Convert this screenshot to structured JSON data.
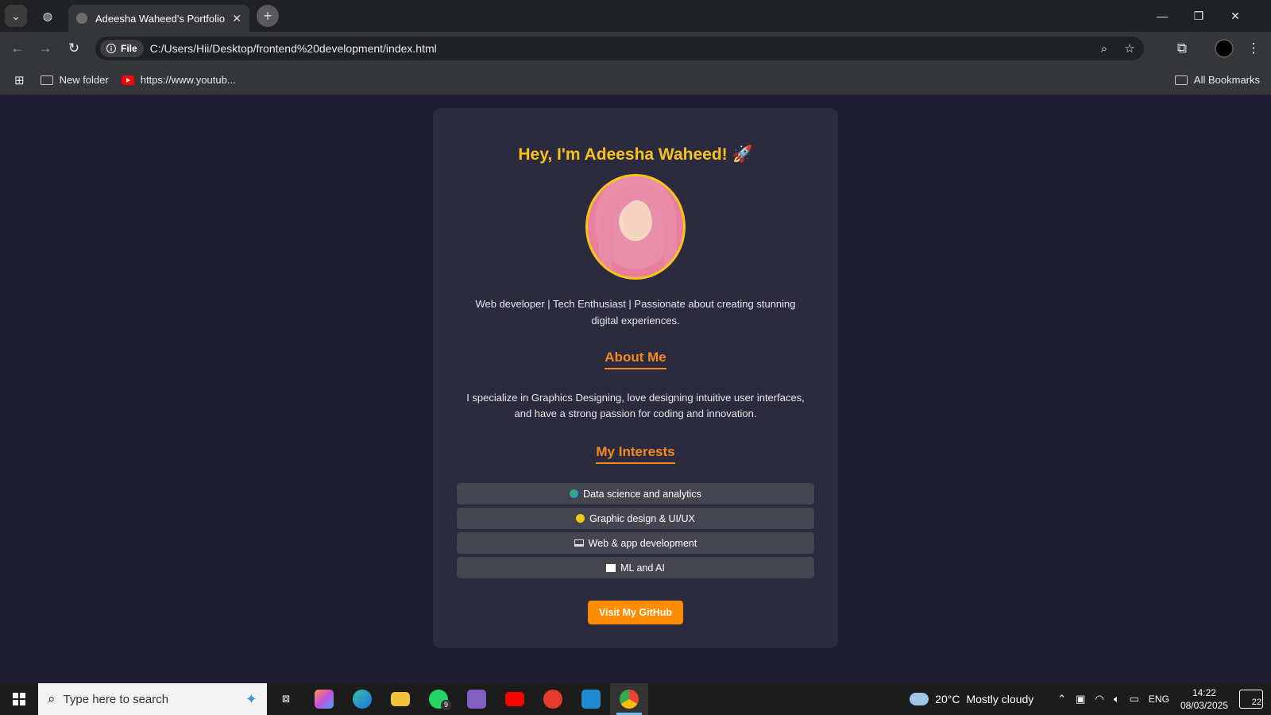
{
  "browser": {
    "tab_title": "Adeesha Waheed's Portfolio",
    "url_chip": "File",
    "url": "C:/Users/Hii/Desktop/frontend%20development/index.html",
    "bookmarks": [
      "New folder",
      "https://www.youtub..."
    ],
    "all_bookmarks": "All Bookmarks"
  },
  "page": {
    "hero": "Hey, I'm Adeesha Waheed! 🚀",
    "tagline": "Web developer | Tech Enthusiast | Passionate about creating stunning digital experiences.",
    "about_title": "About Me",
    "about_text": "I specialize in Graphics Designing, love designing intuitive user interfaces, and have a strong passion for coding and innovation.",
    "interests_title": "My Interests",
    "interests": [
      "Data science and analytics",
      "Graphic design & UI/UX",
      "Web & app development",
      "ML and AI"
    ],
    "github_button": "Visit My GitHub"
  },
  "taskbar": {
    "search_placeholder": "Type here to search",
    "whatsapp_badge": "9",
    "weather_temp": "20°C",
    "weather_desc": "Mostly cloudy",
    "language": "ENG",
    "time": "14:22",
    "date": "08/03/2025",
    "notification_count": "22"
  },
  "colors": {
    "page_bg": "#1e1d33",
    "card_bg": "#2b2a3e",
    "hero": "#f8c21c",
    "accent": "#f58a1f",
    "button": "#ff8c00"
  }
}
